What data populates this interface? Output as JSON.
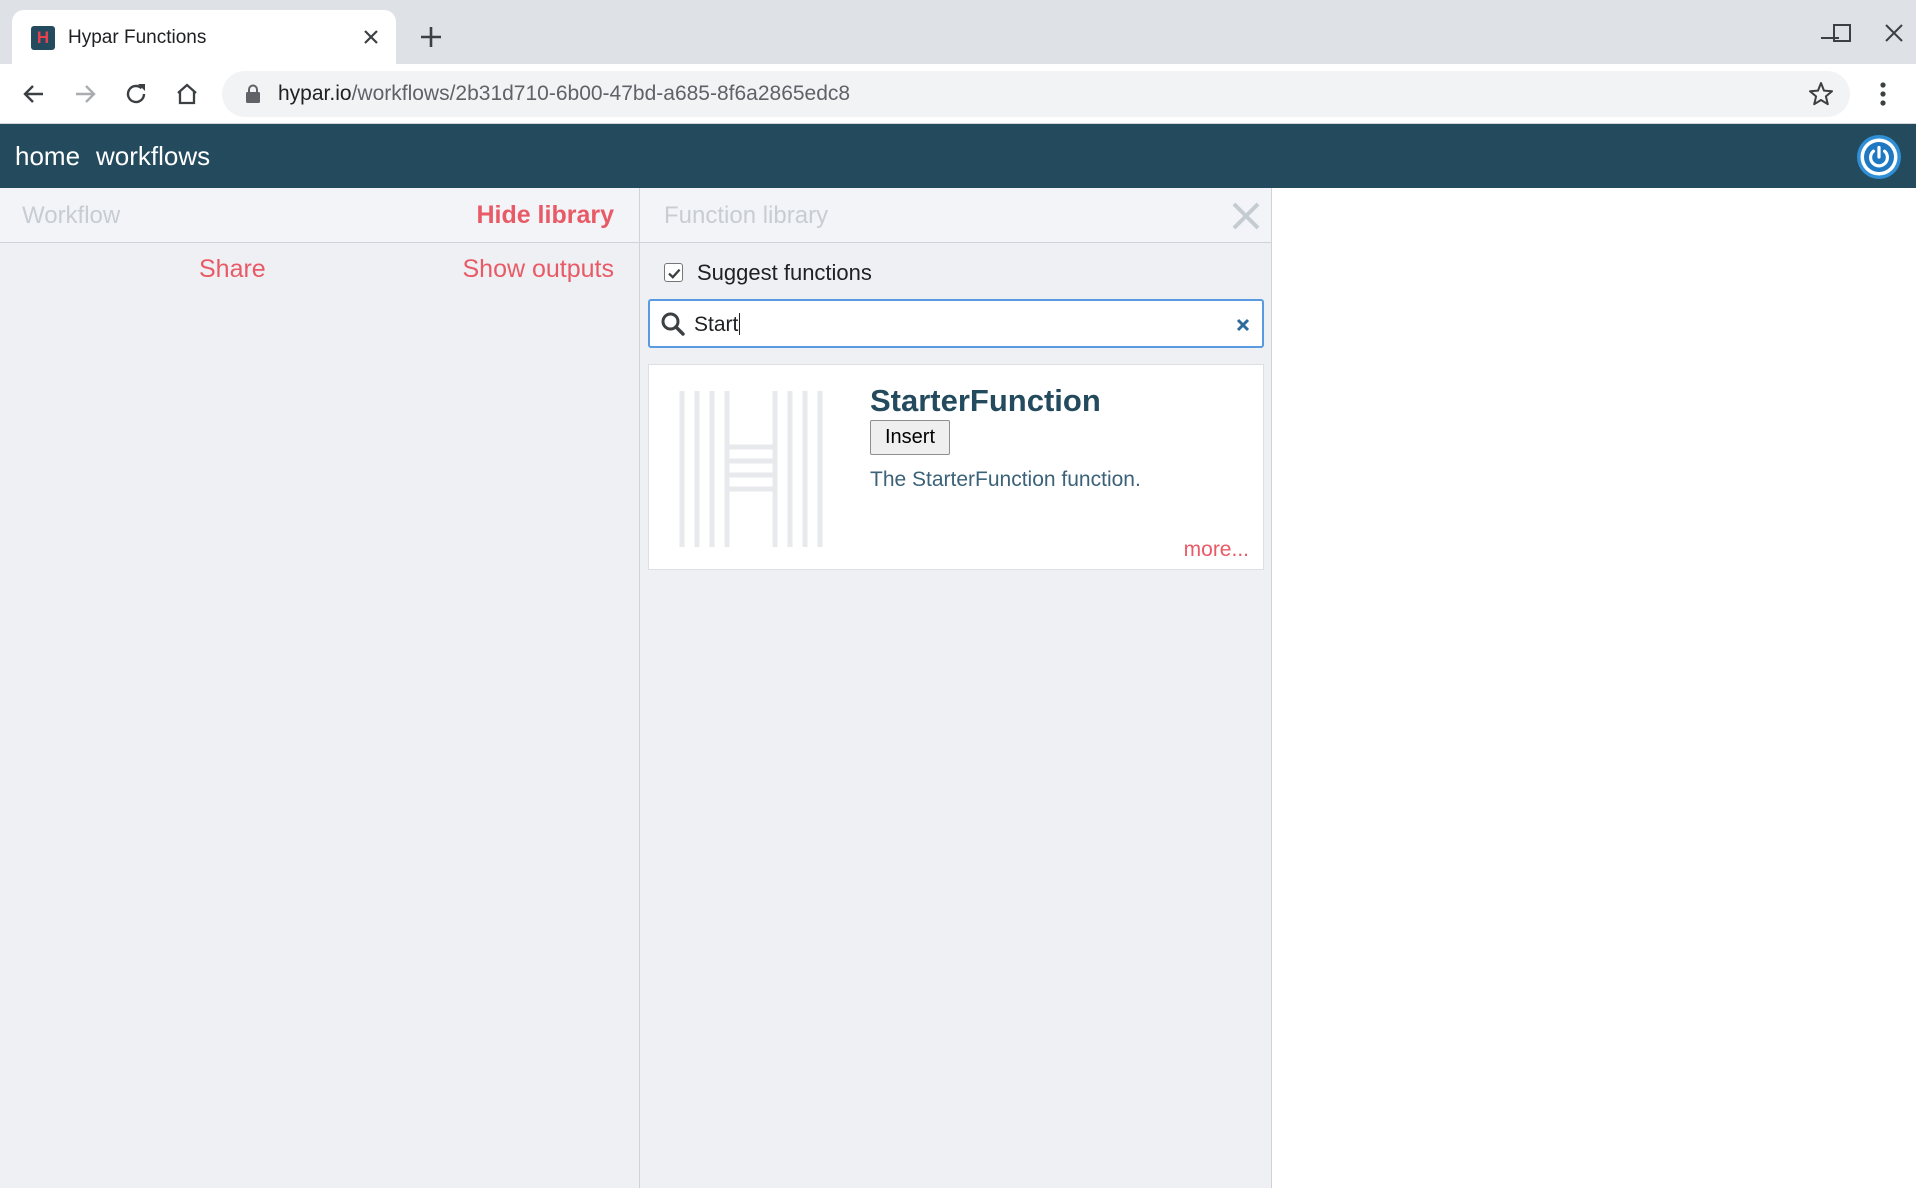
{
  "browser": {
    "tab_title": "Hypar Functions",
    "favicon_letter": "H",
    "url_host": "hypar.io",
    "url_path": "/workflows/2b31d710-6b00-47bd-a685-8f6a2865edc8"
  },
  "nav": {
    "home": "home",
    "workflows": "workflows"
  },
  "workflow_panel": {
    "title": "Workflow",
    "hide_library": "Hide library",
    "share": "Share",
    "show_outputs": "Show outputs"
  },
  "library": {
    "title": "Function library",
    "suggest_label": "Suggest functions",
    "suggest_checked": true,
    "search_value": "Start",
    "results": [
      {
        "name": "StarterFunction",
        "insert_label": "Insert",
        "description": "The StarterFunction function.",
        "more_label": "more..."
      }
    ]
  },
  "colors": {
    "app_header": "#244a5e",
    "accent_link": "#e85a66",
    "panel_bg": "#eff0f4",
    "focus_border": "#5a9ae0"
  },
  "icons": [
    "favicon-hypar",
    "close-tab-icon",
    "new-tab-icon",
    "minimize-icon",
    "maximize-icon",
    "close-window-icon",
    "back-arrow-icon",
    "forward-arrow-icon",
    "reload-icon",
    "home-icon",
    "lock-icon",
    "bookmark-star-icon",
    "menu-kebab-icon",
    "power-icon",
    "close-panel-icon",
    "search-icon",
    "clear-search-icon",
    "hypar-function-logo"
  ]
}
